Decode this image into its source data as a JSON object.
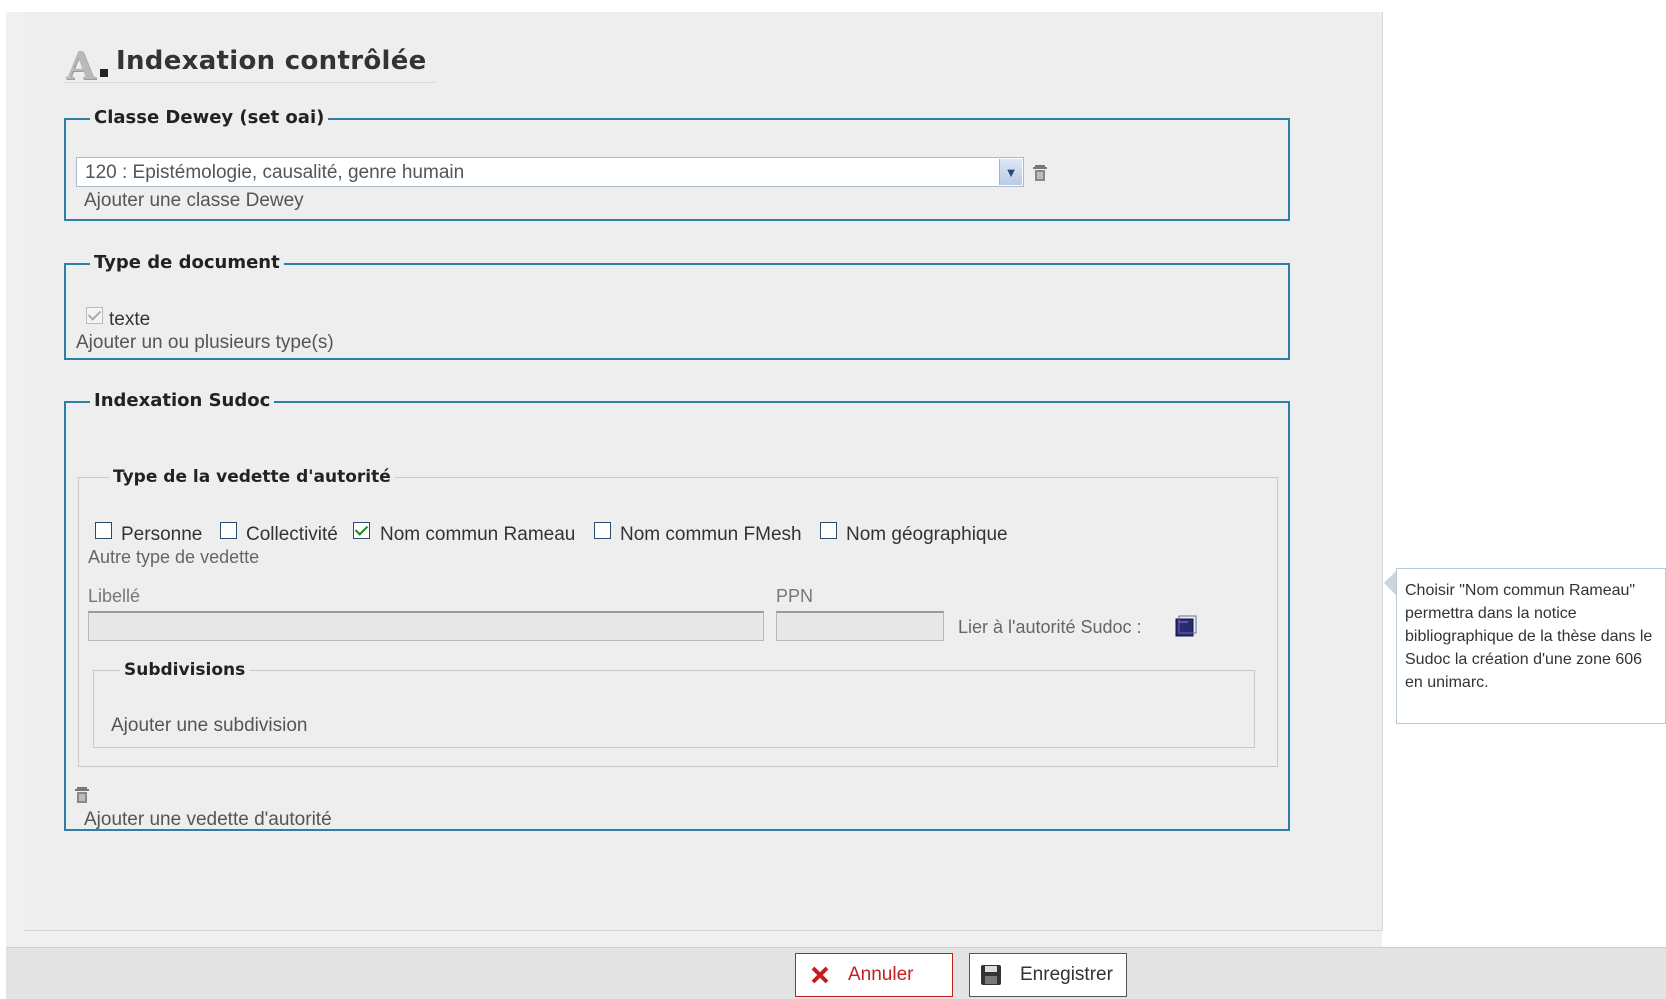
{
  "title": "Indexation contrôlée",
  "dewey": {
    "legend": "Classe Dewey (set oai)",
    "selected": "120 : Epistémologie, causalité, genre humain",
    "add_link": "Ajouter une classe Dewey"
  },
  "doc_type": {
    "legend": "Type de document",
    "checkbox_label": "texte",
    "add_link": "Ajouter un ou plusieurs type(s)"
  },
  "sudoc": {
    "legend": "Indexation Sudoc",
    "vedette": {
      "legend": "Type de la vedette d'autorité",
      "options": [
        {
          "label": "Personne",
          "checked": false
        },
        {
          "label": "Collectivité",
          "checked": false
        },
        {
          "label": "Nom commun Rameau",
          "checked": true
        },
        {
          "label": "Nom commun FMesh",
          "checked": false
        },
        {
          "label": "Nom géographique",
          "checked": false
        }
      ],
      "other_type_link": "Autre type de vedette",
      "libelle_label": "Libellé",
      "libelle_value": "",
      "ppn_label": "PPN",
      "ppn_value": "",
      "link_authority_label": "Lier à l'autorité Sudoc :"
    },
    "subdivisions": {
      "legend": "Subdivisions",
      "add_link": "Ajouter une subdivision"
    },
    "add_vedette_link": "Ajouter une vedette d'autorité"
  },
  "tooltip": "Choisir \"Nom commun Rameau\" permettra dans la notice bibliographique de la thèse dans le Sudoc la création d'une zone 606 en unimarc.",
  "buttons": {
    "cancel": "Annuler",
    "save": "Enregistrer"
  },
  "colors": {
    "fieldset_border": "#2f7fa5",
    "cancel": "#c51e1e",
    "checkmark": "#1a8a1a"
  }
}
